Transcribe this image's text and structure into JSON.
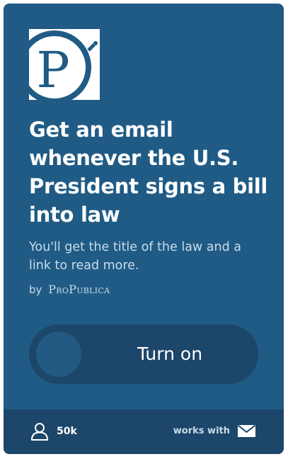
{
  "applet": {
    "logo_letter": "P",
    "title": "Get an email whenever the U.S. President signs a bill into law",
    "description": "You'll get the title of the law and a link to read more.",
    "by_label": "by",
    "author": "ProPublica",
    "toggle_label": "Turn on",
    "user_count": "50k",
    "works_with_label": "works with",
    "service_icon": "mail-icon",
    "colors": {
      "card_background": "#205b85",
      "dark_panel": "#1c466a",
      "text": "#ffffff",
      "muted_text": "#c9dcea"
    }
  }
}
